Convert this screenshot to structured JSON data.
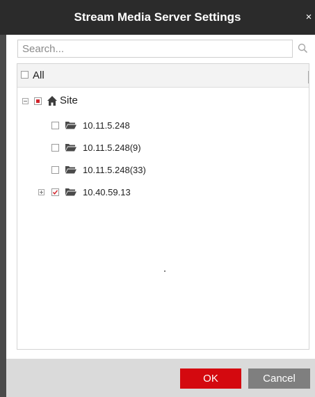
{
  "dialog": {
    "title": "Stream Media Server Settings",
    "close_glyph": "×"
  },
  "search": {
    "placeholder": "Search...",
    "value": ""
  },
  "tree": {
    "all_label": "All",
    "root": {
      "label": "Site",
      "icon": "home-icon",
      "state": "partial",
      "expanded": true
    },
    "children": [
      {
        "label": "10.11.5.248",
        "icon": "folder-icon",
        "checked": false
      },
      {
        "label": "10.11.5.248(9)",
        "icon": "folder-icon",
        "checked": false
      },
      {
        "label": "10.11.5.248(33)",
        "icon": "folder-icon",
        "checked": false
      },
      {
        "label": "10.40.59.13",
        "icon": "folder-icon",
        "checked": true,
        "expandable": true
      }
    ]
  },
  "buttons": {
    "ok_label": "OK",
    "cancel_label": "Cancel"
  },
  "colors": {
    "titlebar": "#2b2b2b",
    "accent_red": "#d4090f",
    "cancel_gray": "#7f7f7f",
    "footer": "#dadada"
  }
}
